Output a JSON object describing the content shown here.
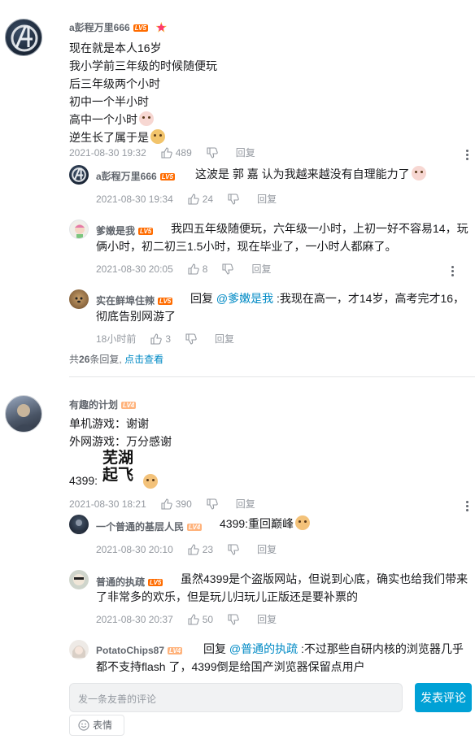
{
  "common": {
    "reply_label": "回复",
    "reply_prefix": "回复"
  },
  "comments": [
    {
      "user": "a彭程万里666",
      "level": "LV5",
      "lines": [
        "现在就是本人16岁",
        "我小学前三年级的时候随便玩",
        "后三年级两个小时",
        "初中一个半小时",
        "高中一个小时",
        "逆生长了属于是"
      ],
      "time": "2021-08-30 19:32",
      "likes": "489",
      "replies": [
        {
          "user": "a彭程万里666",
          "level": "LV5",
          "text": "这波是 郭 嘉 认为我越来越没有自理能力了",
          "time": "2021-08-30 19:34",
          "likes": "24"
        },
        {
          "user": "爹嫩是我",
          "level": "LV5",
          "text_1": "我四五年级随便玩，六年级一小时，上初一好不容易14，玩",
          "text_2": "俩小时，初二初三1.5小时，现在毕业了，一小时人都麻了。",
          "time": "2021-08-30 20:05",
          "likes": "8"
        },
        {
          "user": "实在鲜埠住辣",
          "level": "LV5",
          "mention": "@爹嫩是我",
          "text_1": ":我现在高一，才14岁，高考完才16，",
          "text_2": "彻底告别网游了",
          "time": "18小时前",
          "likes": "3"
        }
      ],
      "replies_summary_prefix": "共",
      "replies_count": "26",
      "replies_summary_suffix": "条回复,",
      "view_link": "点击查看"
    },
    {
      "user": "有趣的计划",
      "level": "LV4",
      "lines": [
        "单机游戏：谢谢",
        "外网游戏：万分感谢"
      ],
      "line_4399": "4399:",
      "sticker_text_1": "芜湖",
      "sticker_text_2": "起飞",
      "time": "2021-08-30 18:21",
      "likes": "390",
      "replies": [
        {
          "user": "一个普通的基层人民",
          "level": "LV4",
          "text": "4399:重回巅峰",
          "time": "2021-08-30 20:10",
          "likes": "23"
        },
        {
          "user": "普通的执疏",
          "level": "LV5",
          "text_1": "虽然4399是个盗版网站，但说到心底，确实也给我们带来",
          "text_2": "了非常多的欢乐，但是玩儿归玩儿正版还是要补票的",
          "time": "2021-08-30 20:37",
          "likes": "50"
        },
        {
          "user": "PotatoChips87",
          "level": "LV4",
          "mention": "@普通的执疏",
          "text_1": ":不过那些自研内核的浏览器几乎",
          "text_2": "都不支持flash 了，4399倒是给国产浏览器保留点用户"
        }
      ]
    }
  ],
  "composer": {
    "placeholder": "发一条友善的评论",
    "submit": "发表评论",
    "emoji": "表情"
  },
  "colors": {
    "accent": "#00a1d6",
    "level5": "#ff6c00",
    "link": "#008ac5"
  }
}
